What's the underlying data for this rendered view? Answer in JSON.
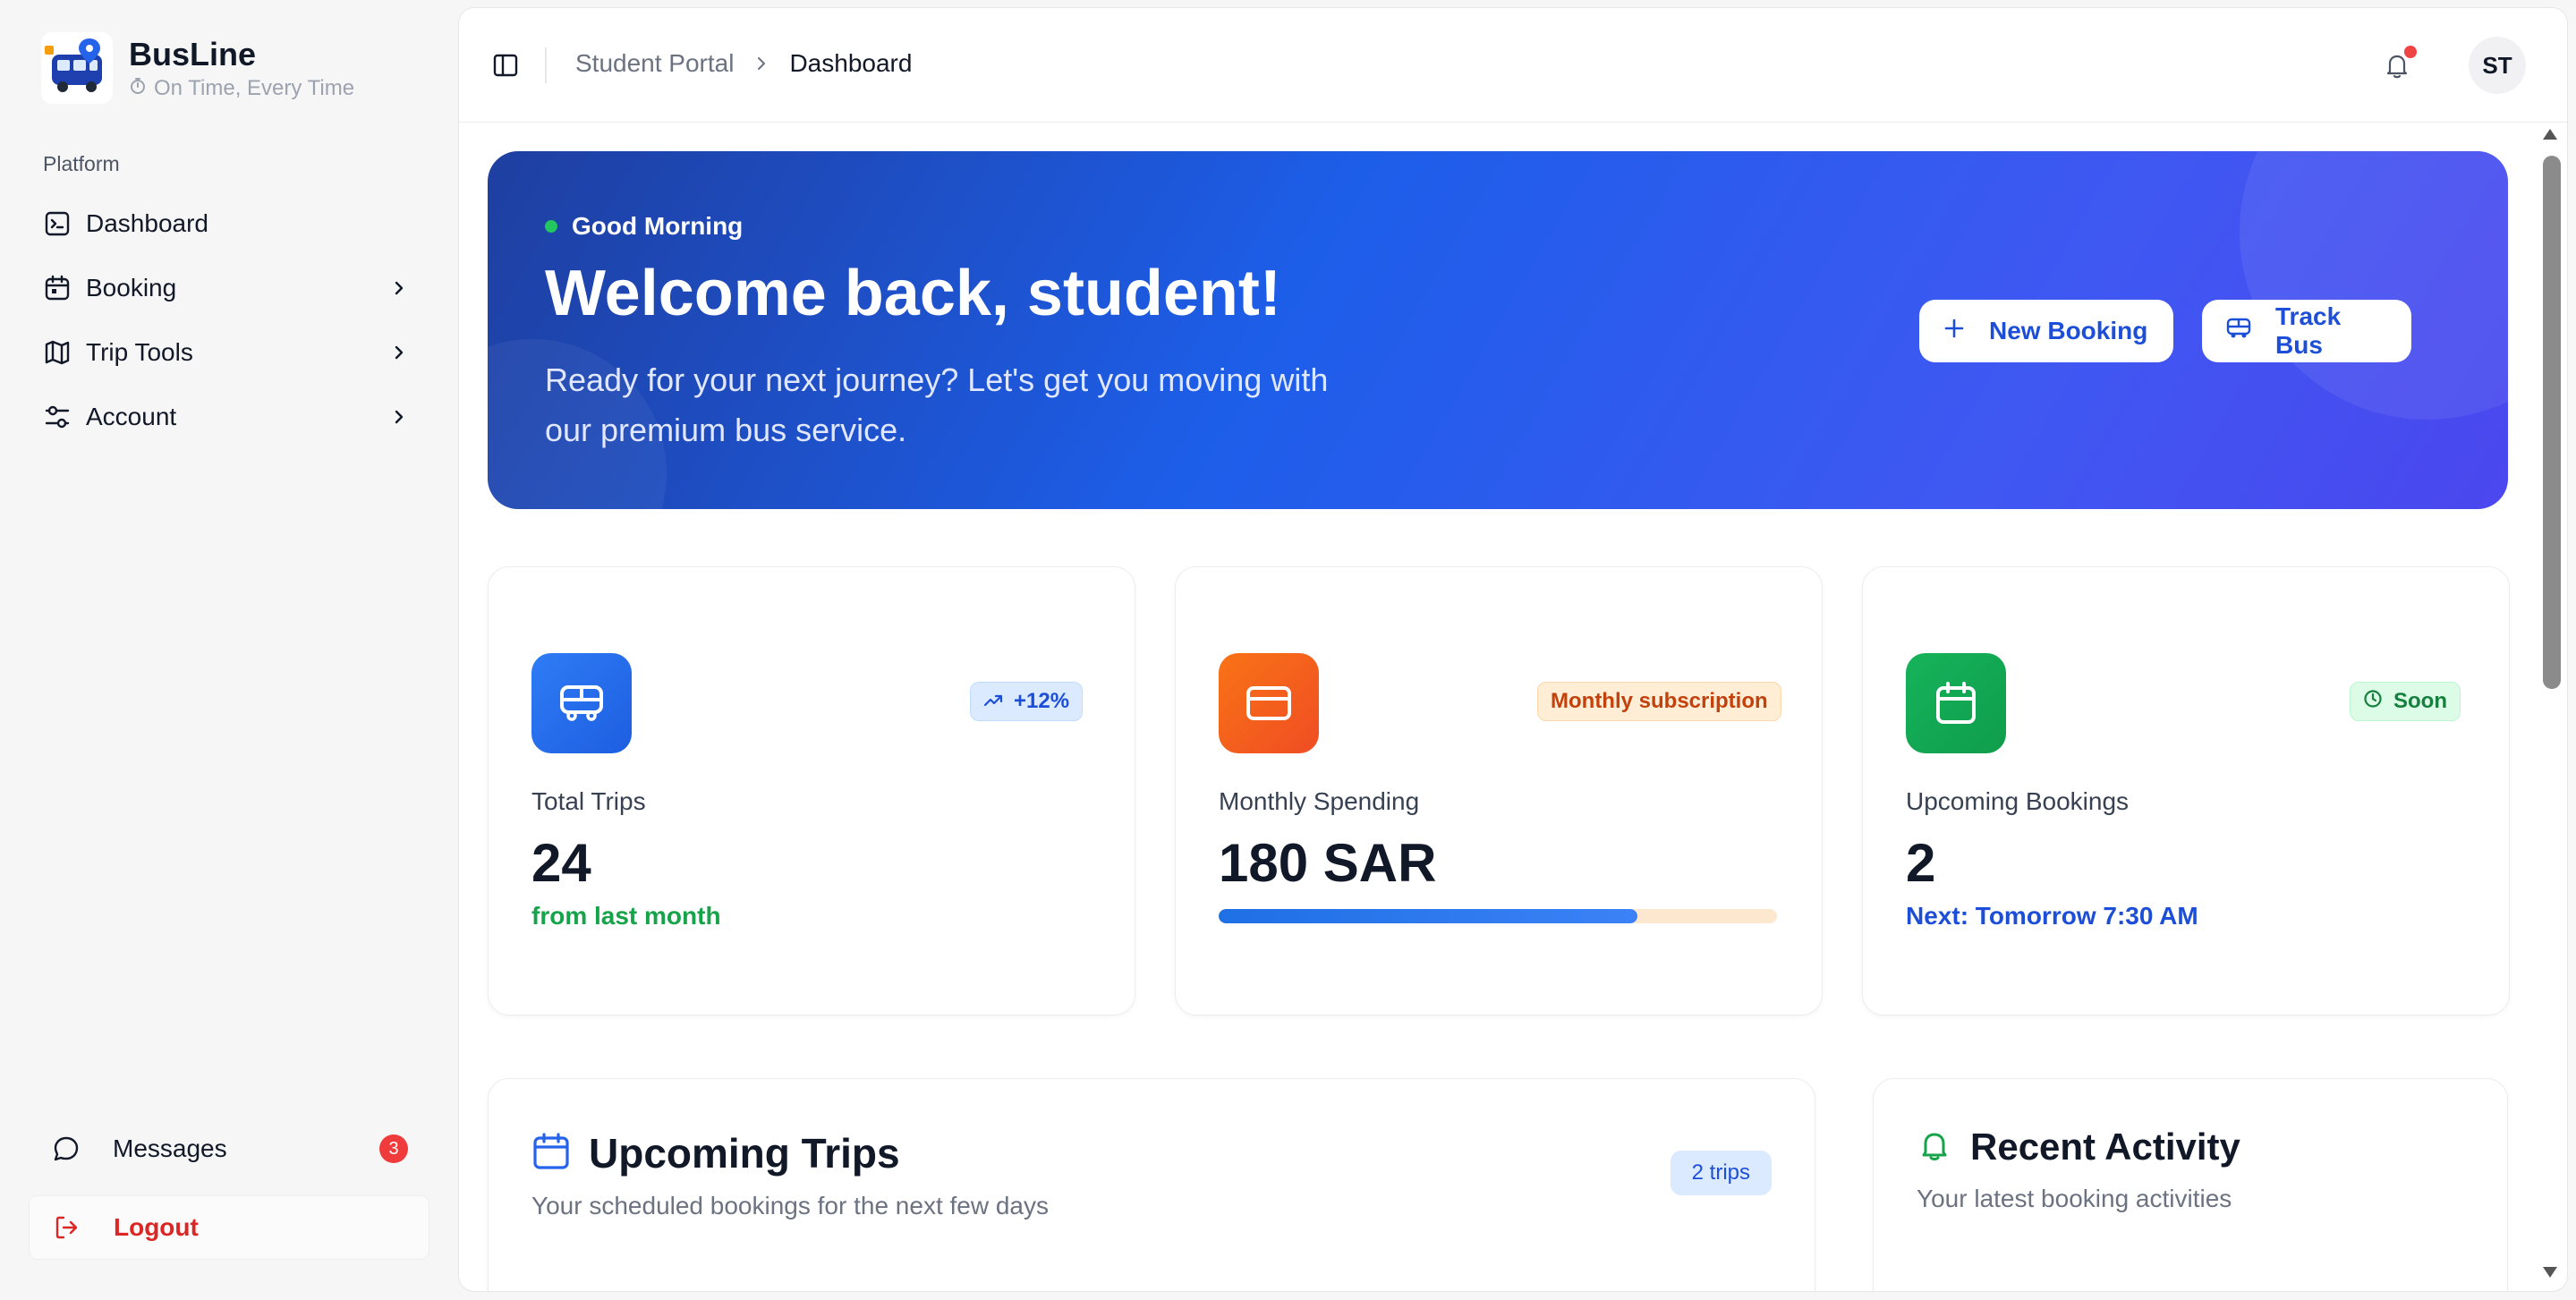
{
  "brand": {
    "name": "BusLine",
    "tagline": "On Time, Every Time"
  },
  "sidebar": {
    "section_label": "Platform",
    "items": [
      {
        "label": "Dashboard",
        "icon": "terminal-square-icon",
        "has_chevron": false
      },
      {
        "label": "Booking",
        "icon": "calendar-icon",
        "has_chevron": true
      },
      {
        "label": "Trip Tools",
        "icon": "map-icon",
        "has_chevron": true
      },
      {
        "label": "Account",
        "icon": "sliders-icon",
        "has_chevron": true
      }
    ],
    "messages": {
      "label": "Messages",
      "badge": "3",
      "icon": "message-circle-icon"
    },
    "logout": {
      "label": "Logout",
      "icon": "logout-icon"
    }
  },
  "topbar": {
    "breadcrumb": [
      "Student Portal",
      "Dashboard"
    ],
    "avatar_initials": "ST",
    "notification_dot": true
  },
  "hero": {
    "greeting": "Good Morning",
    "title": "Welcome back, student!",
    "subtitle": "Ready for your next journey? Let's get you moving with our premium bus service.",
    "new_booking_label": "New Booking",
    "track_bus_label": "Track Bus"
  },
  "stats": [
    {
      "label": "Total Trips",
      "value": "24",
      "pill": "+12%",
      "note": "from last month",
      "color": "#2563eb"
    },
    {
      "label": "Monthly Spending",
      "value": "180 SAR",
      "pill": "Monthly subscription",
      "progress": 0.75,
      "color": "#f97316"
    },
    {
      "label": "Upcoming Bookings",
      "value": "2",
      "pill": "Soon",
      "note": "Next: Tomorrow 7:30 AM",
      "color": "#16a34a"
    }
  ],
  "upcoming": {
    "title": "Upcoming Trips",
    "subtitle": "Your scheduled bookings for the next few days",
    "count_label": "2 trips"
  },
  "activity": {
    "title": "Recent Activity",
    "subtitle": "Your latest booking activities"
  },
  "colors": {
    "primary": "#1d4ed8",
    "danger": "#dc2626",
    "success": "#16a34a"
  }
}
